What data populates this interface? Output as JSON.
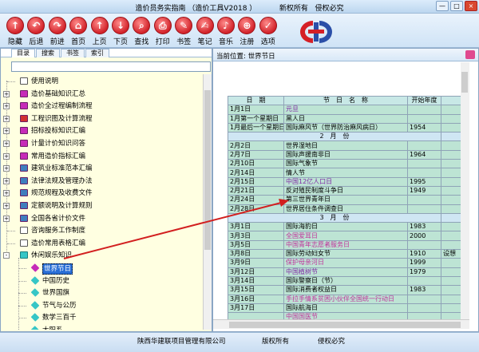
{
  "window": {
    "title": "造价员务实指南 （造价工具V2018 ）          新权所有   侵权必究",
    "buttons": [
      "—",
      "□",
      "×"
    ]
  },
  "toolbar": {
    "buttons": [
      {
        "label": "隐藏",
        "icon": "hide-icon",
        "glyph": "↑"
      },
      {
        "label": "后退",
        "icon": "back-icon",
        "glyph": "↶"
      },
      {
        "label": "前进",
        "icon": "forward-icon",
        "glyph": "↷"
      },
      {
        "label": "首页",
        "icon": "home-icon",
        "glyph": "⌂"
      },
      {
        "label": "上页",
        "icon": "prev-page-icon",
        "glyph": "↑"
      },
      {
        "label": "下页",
        "icon": "next-page-icon",
        "glyph": "↓"
      },
      {
        "label": "查找",
        "icon": "search-icon",
        "glyph": "⌕"
      },
      {
        "label": "打印",
        "icon": "print-icon",
        "glyph": "⎙"
      },
      {
        "label": "书签",
        "icon": "bookmark-icon",
        "glyph": "✎"
      },
      {
        "label": "笔记",
        "icon": "note-icon",
        "glyph": "✍"
      },
      {
        "label": "音乐",
        "icon": "music-icon",
        "glyph": "♪"
      },
      {
        "label": "注册",
        "icon": "register-icon",
        "glyph": "⊕"
      },
      {
        "label": "选项",
        "icon": "options-icon",
        "glyph": "✓"
      }
    ]
  },
  "left": {
    "tabs": [
      "目录",
      "搜索",
      "书签",
      "索引"
    ],
    "search_value": "",
    "tree": [
      {
        "label": "使用说明",
        "type": "doc",
        "expand": ""
      },
      {
        "label": "造价基础知识汇总",
        "type": "book",
        "expand": "+"
      },
      {
        "label": "造价全过程编制流程",
        "type": "book",
        "expand": "+"
      },
      {
        "label": "工程识图及计算流程",
        "type": "book",
        "expand": "+"
      },
      {
        "label": "招标投标知识汇编",
        "type": "book",
        "expand": "+"
      },
      {
        "label": "计量计价知识问答",
        "type": "book",
        "expand": "+"
      },
      {
        "label": "常用造价指标汇编",
        "type": "book",
        "expand": "+"
      },
      {
        "label": "建筑业标准范本汇编",
        "type": "book",
        "expand": "+"
      },
      {
        "label": "法律法规及管理办法",
        "type": "book",
        "expand": "+"
      },
      {
        "label": "规范规程及收费文件",
        "type": "book",
        "expand": "+"
      },
      {
        "label": "定额说明及计算规则",
        "type": "book",
        "expand": "+"
      },
      {
        "label": "全国各省计价文件",
        "type": "book",
        "expand": "+"
      },
      {
        "label": "咨询服务工作制度",
        "type": "doc",
        "expand": ""
      },
      {
        "label": "造价常用表格汇编",
        "type": "doc",
        "expand": ""
      },
      {
        "label": "休闲娱乐知识",
        "type": "open",
        "expand": "-"
      },
      {
        "label": "世界节日",
        "type": "leaf",
        "expand": "",
        "selected": true
      },
      {
        "label": "中国历史",
        "type": "leaf",
        "expand": ""
      },
      {
        "label": "世界国旗",
        "type": "leaf",
        "expand": ""
      },
      {
        "label": "节气与公历",
        "type": "leaf",
        "expand": ""
      },
      {
        "label": "数学三百千",
        "type": "leaf",
        "expand": ""
      },
      {
        "label": "太阳系",
        "type": "leaf",
        "expand": ""
      },
      {
        "label": "职场人生",
        "type": "book",
        "expand": "+"
      }
    ]
  },
  "right": {
    "location_label": "当前位置: 世界节日",
    "columns": [
      "日　期",
      "节　日　名　称",
      "开始年度"
    ],
    "rows": [
      {
        "kind": "row",
        "date": "1月1日",
        "name": "元旦",
        "year": "",
        "style": "lk"
      },
      {
        "kind": "row",
        "date": "1月第一个星期日",
        "name": "黑人日",
        "year": "",
        "style": ""
      },
      {
        "kind": "row",
        "date": "1月最后一个星期日",
        "name": "国际麻风节（世界防治麻风病日）",
        "year": "1954",
        "style": ""
      },
      {
        "kind": "month",
        "label": "2　月　份"
      },
      {
        "kind": "row",
        "date": "2月2日",
        "name": "世界湿地日",
        "year": "",
        "style": ""
      },
      {
        "kind": "row",
        "date": "2月7日",
        "name": "国际声援南非日",
        "year": "1964",
        "style": ""
      },
      {
        "kind": "row",
        "date": "2月10日",
        "name": "国际气象节",
        "year": "",
        "style": ""
      },
      {
        "kind": "row",
        "date": "2月14日",
        "name": "情人节",
        "year": "",
        "style": ""
      },
      {
        "kind": "row",
        "date": "2月15日",
        "name": "中国12亿人口日",
        "year": "1995",
        "style": "lk"
      },
      {
        "kind": "row",
        "date": "2月21日",
        "name": "反对殖民制度斗争日",
        "year": "1949",
        "style": ""
      },
      {
        "kind": "row",
        "date": "2月24日",
        "name": "第三世界青年日",
        "year": "",
        "style": ""
      },
      {
        "kind": "row",
        "date": "2月28日",
        "name": "世界居住条件调查日",
        "year": "",
        "style": ""
      },
      {
        "kind": "month",
        "label": "3　月　份"
      },
      {
        "kind": "row",
        "date": "3月1日",
        "name": "国际海豹日",
        "year": "1983",
        "style": ""
      },
      {
        "kind": "row",
        "date": "3月3日",
        "name": "全国爱耳日",
        "year": "2000",
        "style": "pk"
      },
      {
        "kind": "row",
        "date": "3月5日",
        "name": "中国青年志愿者服务日",
        "year": "",
        "style": "pk"
      },
      {
        "kind": "row",
        "date": "3月8日",
        "name": "国际劳动妇女节",
        "year": "1910",
        "style": ""
      },
      {
        "kind": "row",
        "date": "3月9日",
        "name": "保护母亲河日",
        "year": "1999",
        "style": "pk"
      },
      {
        "kind": "row",
        "date": "3月12日",
        "name": "中国植树节",
        "year": "1979",
        "style": "lk"
      },
      {
        "kind": "row",
        "date": "3月14日",
        "name": "国际警察日（节）",
        "year": "",
        "style": ""
      },
      {
        "kind": "row",
        "date": "3月15日",
        "name": "国际消费者权益日",
        "year": "1983",
        "style": ""
      },
      {
        "kind": "row",
        "date": "3月16日",
        "name": "手拉手情系贫困小伙伴全国统一行动日",
        "year": "",
        "style": "pk"
      },
      {
        "kind": "row",
        "date": "3月17日",
        "name": "国际航海日",
        "year": "",
        "style": ""
      },
      {
        "kind": "row",
        "date": "",
        "name": "中国国医节",
        "year": "",
        "style": "pk"
      }
    ],
    "extra_cell": "设想"
  },
  "status": {
    "company": "陕西华建联项目管理有限公司",
    "rights": "版权所有",
    "warn": "侵权必究"
  }
}
